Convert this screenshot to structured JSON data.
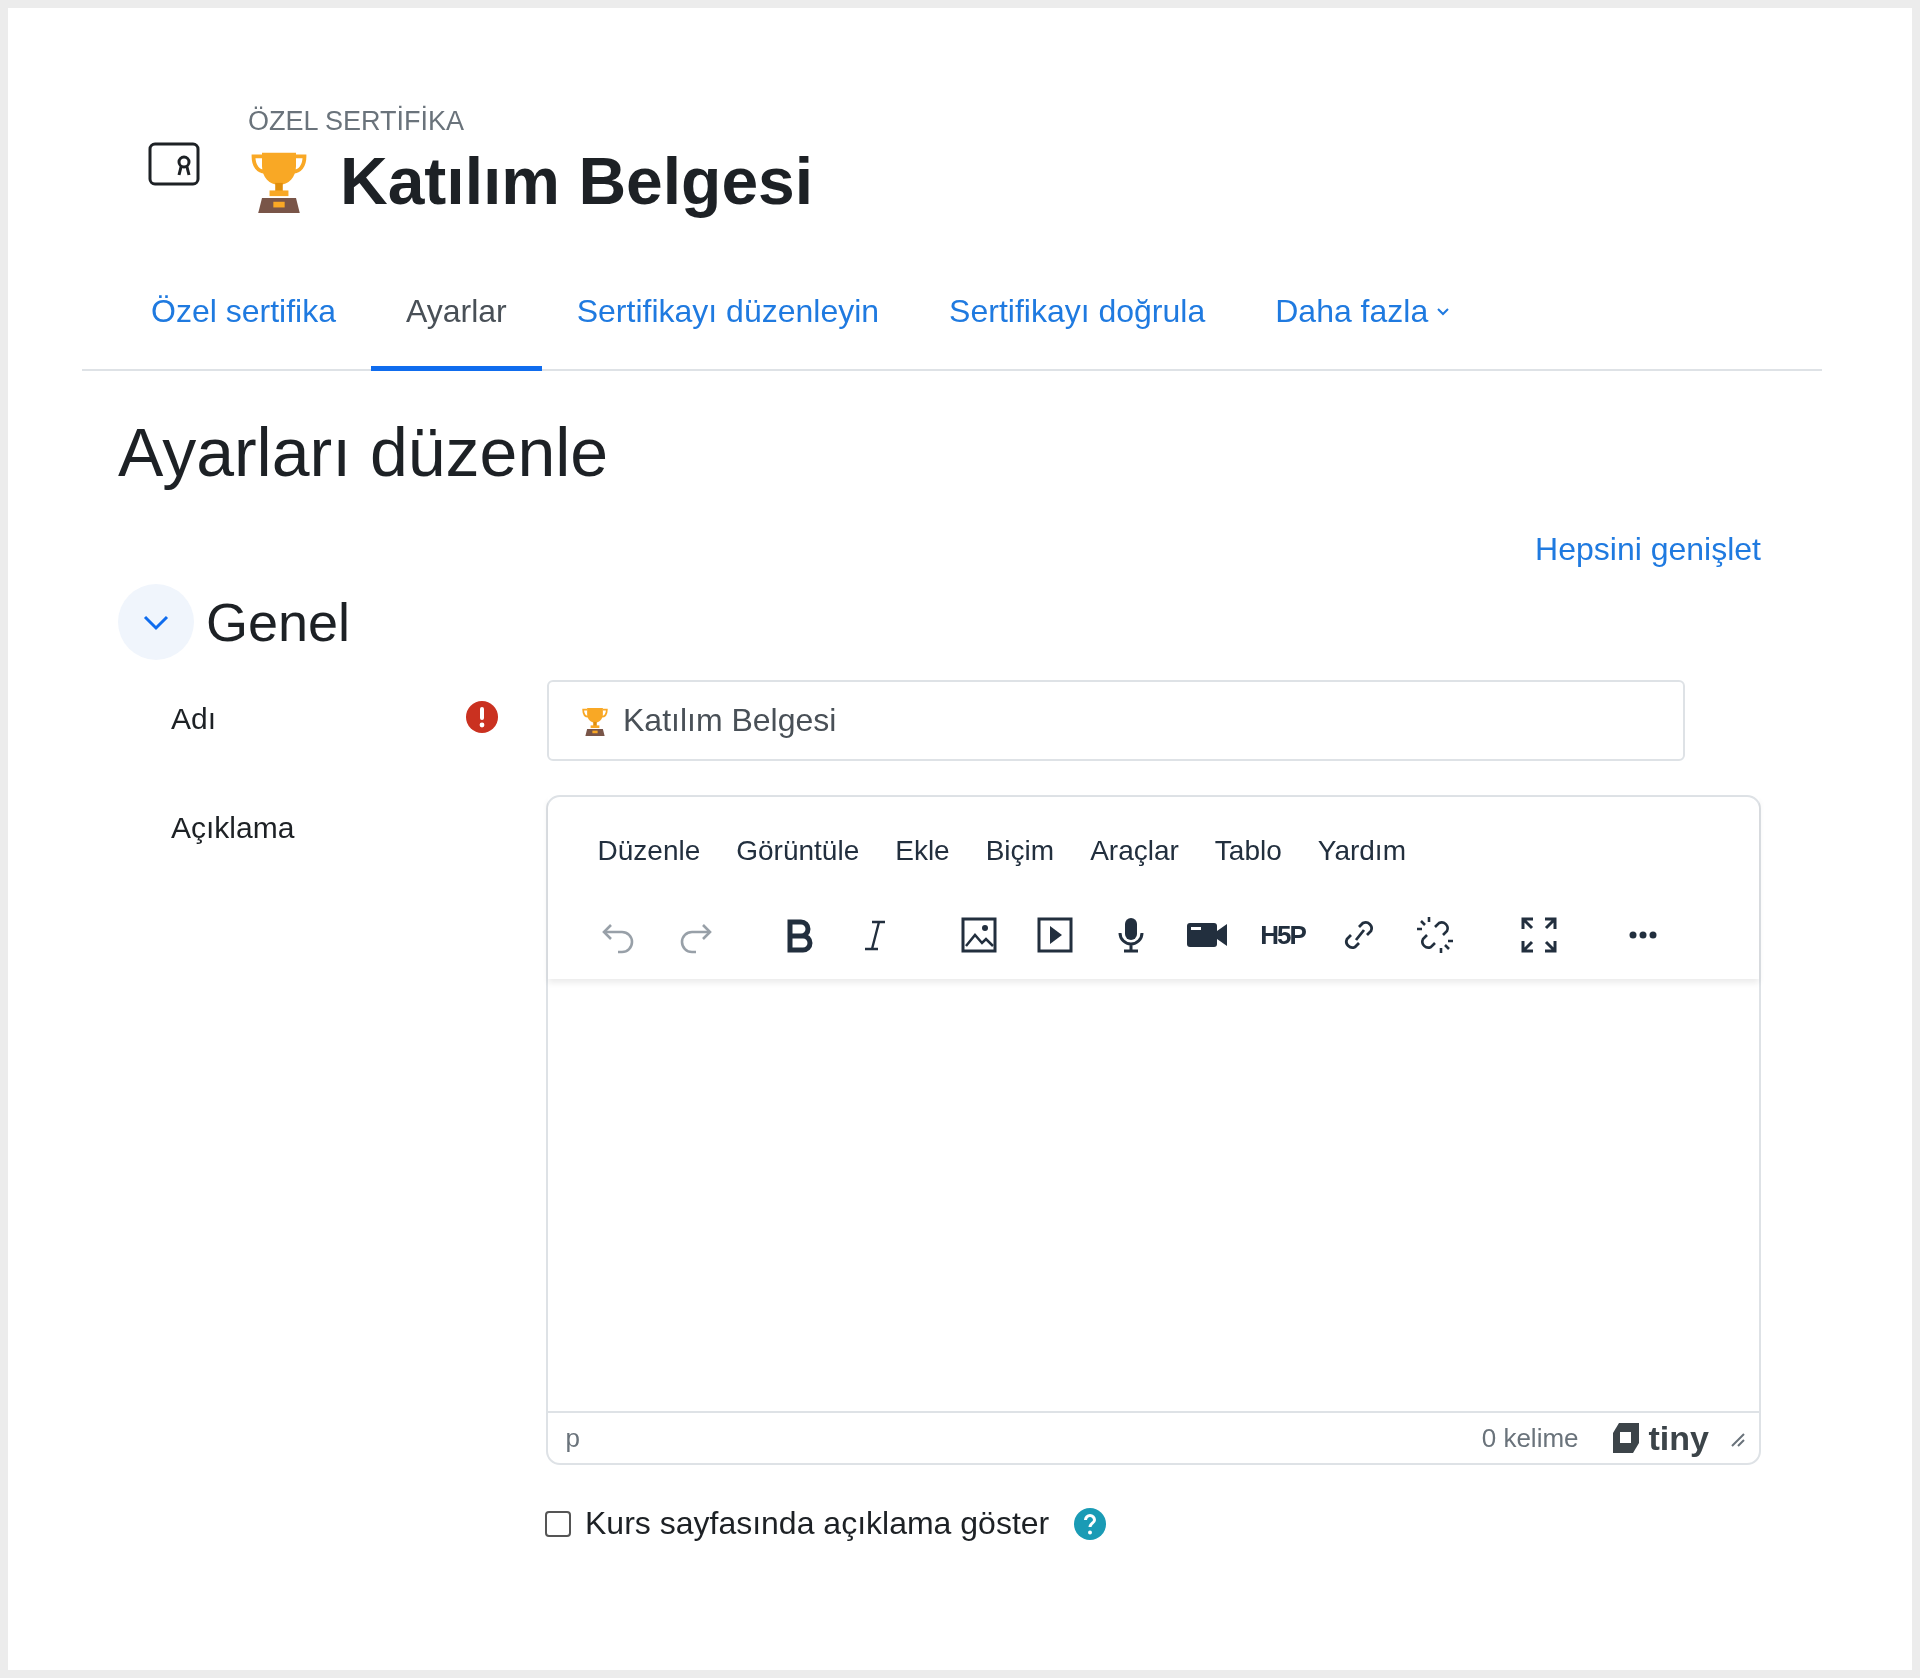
{
  "header": {
    "kicker": "ÖZEL SERTİFİKA",
    "title": "Katılım Belgesi"
  },
  "tabs": [
    {
      "label": "Özel sertifika",
      "selected": false,
      "kind": "link"
    },
    {
      "label": "Ayarlar",
      "selected": true,
      "kind": "link"
    },
    {
      "label": "Sertifikayı düzenleyin",
      "selected": false,
      "kind": "link"
    },
    {
      "label": "Sertifikayı doğrula",
      "selected": false,
      "kind": "link"
    },
    {
      "label": "Daha fazla",
      "selected": false,
      "kind": "dropdown"
    }
  ],
  "page_heading": "Ayarları düzenle",
  "expand_all": "Hepsini genişlet",
  "section": {
    "title": "Genel",
    "expanded": true
  },
  "name_field": {
    "label": "Adı",
    "required": true,
    "value": "Katılım Belgesi"
  },
  "description": {
    "label": "Açıklama",
    "menu": [
      "Düzenle",
      "Görüntüle",
      "Ekle",
      "Biçim",
      "Araçlar",
      "Tablo",
      "Yardım"
    ],
    "toolbar_groups": [
      {
        "items": [
          {
            "kind": "undo",
            "disabled": true
          },
          {
            "kind": "redo",
            "disabled": true
          }
        ]
      },
      {
        "items": [
          {
            "kind": "bold",
            "disabled": false
          },
          {
            "kind": "italic",
            "disabled": false
          }
        ]
      },
      {
        "items": [
          {
            "kind": "image",
            "disabled": false
          },
          {
            "kind": "media",
            "disabled": false
          },
          {
            "kind": "mic",
            "disabled": false
          },
          {
            "kind": "camera",
            "disabled": false
          },
          {
            "kind": "text",
            "label": "H5P",
            "disabled": false
          },
          {
            "kind": "link",
            "disabled": false
          },
          {
            "kind": "unlink",
            "disabled": false
          }
        ]
      },
      {
        "items": [
          {
            "kind": "fullscreen",
            "disabled": false
          }
        ]
      },
      {
        "items": [
          {
            "kind": "more",
            "disabled": false
          }
        ]
      }
    ],
    "path": "p",
    "word_count": "0 kelime",
    "brand": "tiny"
  },
  "show_on_course": {
    "label": "Kurs sayfasında açıklama göster",
    "checked": false
  }
}
